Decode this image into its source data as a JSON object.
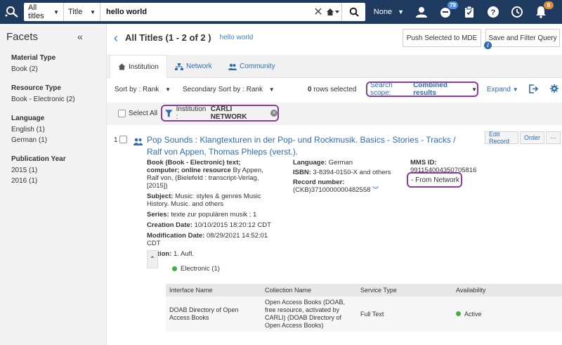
{
  "top": {
    "scope": "All titles",
    "field": "Title",
    "query": "hello world",
    "profile": "None",
    "badges": {
      "tasks": "79",
      "alerts": "6"
    },
    "colors": {
      "bar": "#1f3a5f",
      "accent": "#3b7fc4",
      "highlight": "#8a3d9b"
    }
  },
  "sidebar": {
    "title": "Facets",
    "groups": [
      {
        "head": "Material Type",
        "items": [
          "Book (2)"
        ]
      },
      {
        "head": "Resource Type",
        "items": [
          "Book - Electronic (2)"
        ]
      },
      {
        "head": "Language",
        "items": [
          "English (1)",
          "German (1)"
        ]
      },
      {
        "head": "Publication Year",
        "items": [
          "2015 (1)",
          "2016 (1)"
        ]
      }
    ]
  },
  "main": {
    "title": "All Titles (1 - 2 of 2 )",
    "query_link": "hello world",
    "btn_mde": "Push Selected to MDE",
    "btn_save": "Save and Filter Query",
    "info": "i",
    "tabs": [
      "Institution",
      "Network",
      "Community"
    ],
    "sort_by_label": "Sort by :",
    "sort_by_value": "Rank",
    "secondary_label": "Secondary Sort by :",
    "secondary_value": "Rank",
    "rows_selected": "0",
    "rows_selected_label": "rows selected",
    "scope_label": "Search scope:",
    "scope_value": "Combined results",
    "expand": "Expand",
    "select_all": "Select All",
    "chip_label": "Institution :",
    "chip_value": "CARLI NETWORK"
  },
  "record": {
    "number": "1",
    "title": "Pop Sounds : Klangtexturen in der Pop- und Rockmusik. Basics - Stories - Tracks / Ralf von Appen, Thomas Phleps (verst.).",
    "edit": "Edit Record",
    "order": "Order",
    "more": "···",
    "type_bold": "Book (Book - Electronic) text; computer; online resource",
    "type_rest": "By Appen, Ralf von, (Bielefeld : transcript-Verlag, [2015])",
    "subject_label": "Subject:",
    "subject": "Music: styles & genres Music History. Music. and others",
    "series_label": "Series:",
    "series": "texte zur populären musik ; 1",
    "created_label": "Creation Date:",
    "created": "10/10/2015 18:20:12 CDT",
    "modified_label": "Modification Date:",
    "modified": "08/29/2021 14:52:01 CDT",
    "edition_label": "Edition:",
    "edition": "1. Aufl.",
    "language_label": "Language:",
    "language": "German",
    "isbn_label": "ISBN:",
    "isbn": "3-8394-0150-X and others",
    "recnum_label": "Record number:",
    "recnum": "(CKB)3710000000482558",
    "mms_label": "MMS ID:",
    "mms": "991154004350705816",
    "from_network": "- From Network",
    "electronic": "Electronic (1)"
  },
  "table": {
    "headers": [
      "Interface Name",
      "Collection Name",
      "Service Type",
      "Availability"
    ],
    "row": {
      "interface": "DOAB Directory of Open Access Books",
      "collection": "Open Access Books (DOAB, free resource, activated by CARLI) (DOAB Directory of Open Access Books)",
      "service": "Full Text",
      "availability": "Active"
    }
  }
}
